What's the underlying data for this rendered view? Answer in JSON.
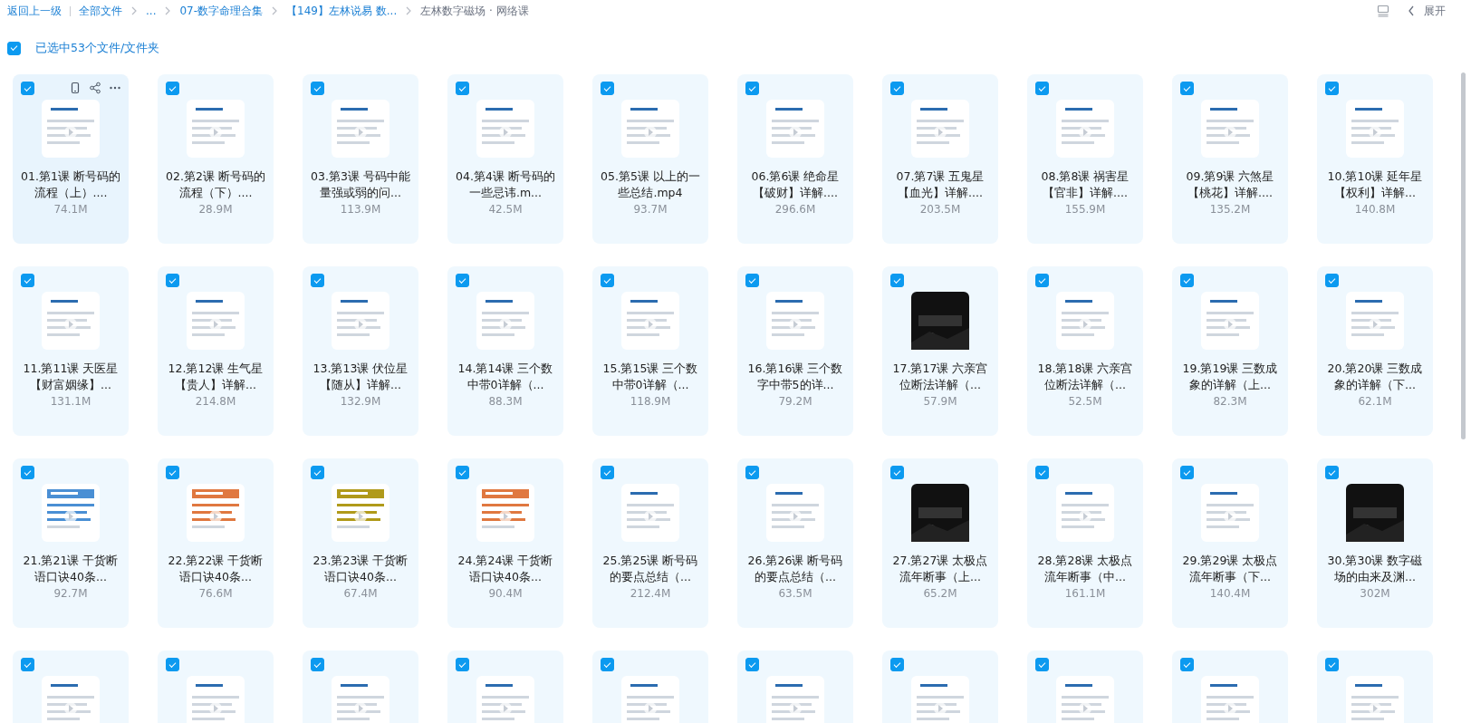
{
  "breadcrumb": {
    "back": "返回上一级",
    "crumbs": [
      {
        "label": "全部文件",
        "current": false
      },
      {
        "label": "...",
        "current": false
      },
      {
        "label": "07-数字命理合集",
        "current": false
      },
      {
        "label": "【149】左林说易 数...",
        "current": false
      },
      {
        "label": "左林数字磁场 · 网络课",
        "current": true
      }
    ]
  },
  "toolbar": {
    "expand": "展开"
  },
  "selection": {
    "checked": true,
    "label": "已选中53个文件/文件夹"
  },
  "files": [
    {
      "name": "01.第1课 断号码的流程（上）....",
      "size": "74.1M",
      "checked": true,
      "hovered": true
    },
    {
      "name": "02.第2课 断号码的流程（下）....",
      "size": "28.9M",
      "checked": true,
      "hovered": false
    },
    {
      "name": "03.第3课 号码中能量强或弱的问...",
      "size": "113.9M",
      "checked": true,
      "hovered": false
    },
    {
      "name": "04.第4课 断号码的一些忌讳.m...",
      "size": "42.5M",
      "checked": true,
      "hovered": false
    },
    {
      "name": "05.第5课 以上的一些总结.mp4",
      "size": "93.7M",
      "checked": true,
      "hovered": false
    },
    {
      "name": "06.第6课 绝命星【破财】详解....",
      "size": "296.6M",
      "checked": true,
      "hovered": false
    },
    {
      "name": "07.第7课 五鬼星【血光】详解....",
      "size": "203.5M",
      "checked": true,
      "hovered": false
    },
    {
      "name": "08.第8课 祸害星【官非】详解....",
      "size": "155.9M",
      "checked": true,
      "hovered": false
    },
    {
      "name": "09.第9课 六煞星【桃花】详解....",
      "size": "135.2M",
      "checked": true,
      "hovered": false
    },
    {
      "name": "10.第10课 延年星【权利】详解...",
      "size": "140.8M",
      "checked": true,
      "hovered": false
    },
    {
      "name": "11.第11课 天医星【财富姻缘】...",
      "size": "131.1M",
      "checked": true,
      "hovered": false
    },
    {
      "name": "12.第12课 生气星【贵人】详解...",
      "size": "214.8M",
      "checked": true,
      "hovered": false
    },
    {
      "name": "13.第13课 伏位星【随从】详解...",
      "size": "132.9M",
      "checked": true,
      "hovered": false
    },
    {
      "name": "14.第14课 三个数中带0详解（...",
      "size": "88.3M",
      "checked": true,
      "hovered": false
    },
    {
      "name": "15.第15课 三个数中带0详解（...",
      "size": "118.9M",
      "checked": true,
      "hovered": false
    },
    {
      "name": "16.第16课 三个数字中带5的详...",
      "size": "79.2M",
      "checked": true,
      "hovered": false
    },
    {
      "name": "17.第17课 六亲宫位断法详解（...",
      "size": "57.9M",
      "checked": true,
      "hovered": false
    },
    {
      "name": "18.第18课 六亲宫位断法详解（...",
      "size": "52.5M",
      "checked": true,
      "hovered": false
    },
    {
      "name": "19.第19课 三数成象的详解（上...",
      "size": "82.3M",
      "checked": true,
      "hovered": false
    },
    {
      "name": "20.第20课 三数成象的详解（下...",
      "size": "62.1M",
      "checked": true,
      "hovered": false
    },
    {
      "name": "21.第21课 干货断语口诀40条...",
      "size": "92.7M",
      "checked": true,
      "hovered": false
    },
    {
      "name": "22.第22课 干货断语口诀40条...",
      "size": "76.6M",
      "checked": true,
      "hovered": false
    },
    {
      "name": "23.第23课 干货断语口诀40条...",
      "size": "67.4M",
      "checked": true,
      "hovered": false
    },
    {
      "name": "24.第24课 干货断语口诀40条...",
      "size": "90.4M",
      "checked": true,
      "hovered": false
    },
    {
      "name": "25.第25课 断号码的要点总结（...",
      "size": "212.4M",
      "checked": true,
      "hovered": false
    },
    {
      "name": "26.第26课 断号码的要点总结（...",
      "size": "63.5M",
      "checked": true,
      "hovered": false
    },
    {
      "name": "27.第27课 太极点流年断事（上...",
      "size": "65.2M",
      "checked": true,
      "hovered": false
    },
    {
      "name": "28.第28课 太极点流年断事（中...",
      "size": "161.1M",
      "checked": true,
      "hovered": false
    },
    {
      "name": "29.第29课 太极点流年断事（下...",
      "size": "140.4M",
      "checked": true,
      "hovered": false
    },
    {
      "name": "30.第30课 数字磁场的由来及渊...",
      "size": "302M",
      "checked": true,
      "hovered": false
    },
    {
      "checked": true,
      "hovered": false
    },
    {
      "checked": true,
      "hovered": false
    },
    {
      "checked": true,
      "hovered": false
    },
    {
      "checked": true,
      "hovered": false
    },
    {
      "checked": true,
      "hovered": false
    },
    {
      "checked": true,
      "hovered": false
    },
    {
      "checked": true,
      "hovered": false
    },
    {
      "checked": true,
      "hovered": false
    },
    {
      "checked": true,
      "hovered": false
    },
    {
      "checked": true,
      "hovered": false
    }
  ]
}
